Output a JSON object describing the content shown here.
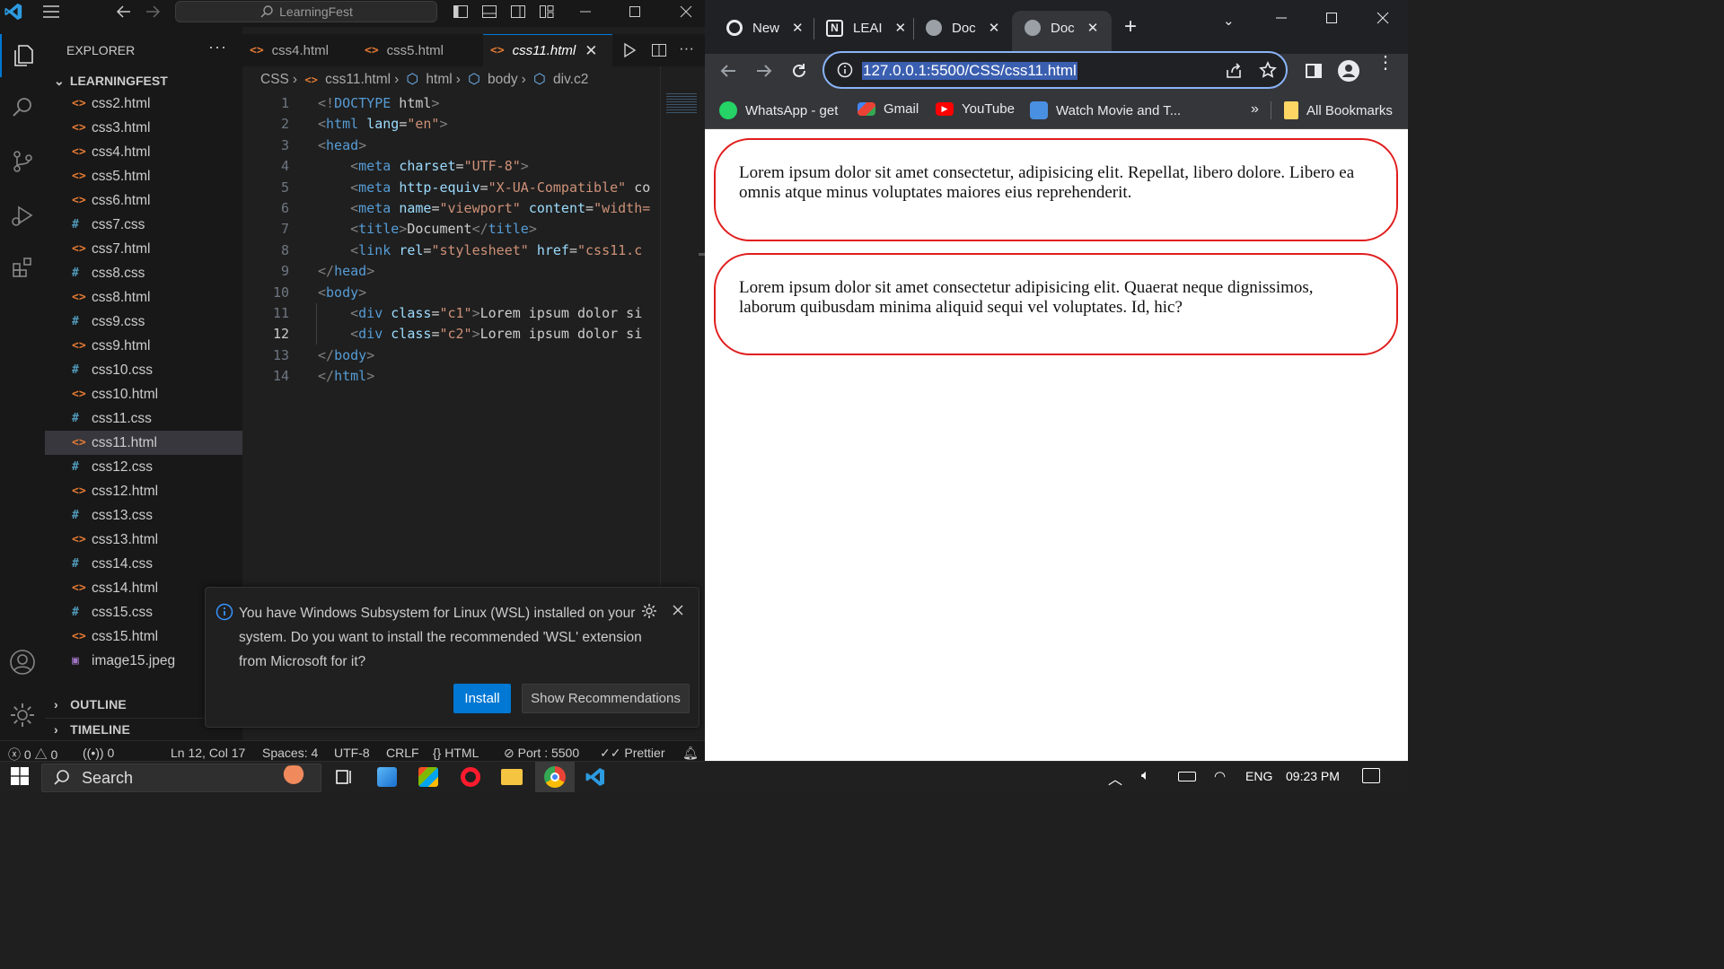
{
  "vscode": {
    "search_text": "LearningFest",
    "explorer_title": "EXPLORER",
    "explorer_more": "···",
    "root_folder": "LEARNINGFEST",
    "files": [
      {
        "name": "css2.html",
        "type": "html"
      },
      {
        "name": "css3.html",
        "type": "html"
      },
      {
        "name": "css4.html",
        "type": "html"
      },
      {
        "name": "css5.html",
        "type": "html"
      },
      {
        "name": "css6.html",
        "type": "html"
      },
      {
        "name": "css7.css",
        "type": "css"
      },
      {
        "name": "css7.html",
        "type": "html"
      },
      {
        "name": "css8.css",
        "type": "css"
      },
      {
        "name": "css8.html",
        "type": "html"
      },
      {
        "name": "css9.css",
        "type": "css"
      },
      {
        "name": "css9.html",
        "type": "html"
      },
      {
        "name": "css10.css",
        "type": "css"
      },
      {
        "name": "css10.html",
        "type": "html"
      },
      {
        "name": "css11.css",
        "type": "css"
      },
      {
        "name": "css11.html",
        "type": "html",
        "selected": true
      },
      {
        "name": "css12.css",
        "type": "css"
      },
      {
        "name": "css12.html",
        "type": "html"
      },
      {
        "name": "css13.css",
        "type": "css"
      },
      {
        "name": "css13.html",
        "type": "html"
      },
      {
        "name": "css14.css",
        "type": "css"
      },
      {
        "name": "css14.html",
        "type": "html"
      },
      {
        "name": "css15.css",
        "type": "css"
      },
      {
        "name": "css15.html",
        "type": "html"
      },
      {
        "name": "image15.jpeg",
        "type": "img"
      }
    ],
    "outline_label": "OUTLINE",
    "timeline_label": "TIMELINE",
    "tabs": [
      {
        "label": "css4.html"
      },
      {
        "label": "css5.html"
      },
      {
        "label": "css11.html",
        "active": true
      }
    ],
    "breadcrumb": [
      "CSS",
      "css11.html",
      "html",
      "body",
      "div.c2"
    ],
    "code_lines": [
      "<!DOCTYPE html>",
      "<html lang=\"en\">",
      "<head>",
      "    <meta charset=\"UTF-8\">",
      "    <meta http-equiv=\"X-UA-Compatible\" co",
      "    <meta name=\"viewport\" content=\"width=",
      "    <title>Document</title>",
      "    <link rel=\"stylesheet\" href=\"css11.c",
      "</head>",
      "<body>",
      "    <div class=\"c1\">Lorem ipsum dolor si",
      "    <div class=\"c2\">Lorem ipsum dolor si",
      "</body>",
      "</html>"
    ],
    "current_line": 12,
    "notification": {
      "message": "You have Windows Subsystem for Linux (WSL) installed on your system. Do you want to install the recommended 'WSL' extension from Microsoft for it?",
      "install_label": "Install",
      "recommend_label": "Show Recommendations"
    },
    "status": {
      "errors": "0",
      "warnings": "0",
      "ports": "0",
      "position": "Ln 12, Col 17",
      "spaces": "Spaces: 4",
      "encoding": "UTF-8",
      "eol": "CRLF",
      "language": "HTML",
      "port": "Port : 5500",
      "formatter": "Prettier"
    }
  },
  "chrome": {
    "tabs": [
      {
        "label": "New"
      },
      {
        "label": "LEAI"
      },
      {
        "label": "Doc"
      },
      {
        "label": "Doc",
        "active": true
      }
    ],
    "url": "127.0.0.1:5500/CSS/css11.html",
    "bookmarks": [
      {
        "label": "WhatsApp - get",
        "color": "#25d366"
      },
      {
        "label": "Gmail",
        "color": "#ea4335"
      },
      {
        "label": "YouTube",
        "color": "#ff0000"
      },
      {
        "label": "Watch Movie and T...",
        "color": "#4a90e2"
      }
    ],
    "bookmarks_more": "»",
    "all_bookmarks": "All Bookmarks",
    "page": {
      "box1": "Lorem ipsum dolor sit amet consectetur, adipisicing elit. Repellat, libero dolore. Libero ea omnis atque minus voluptates maiores eius reprehenderit.",
      "box2": "Lorem ipsum dolor sit amet consectetur adipisicing elit. Quaerat neque dignissimos, laborum quibusdam minima aliquid sequi vel voluptates. Id, hic?"
    },
    "border_color": "#e11d1d"
  },
  "taskbar": {
    "search_label": "Search",
    "language": "ENG",
    "time": "09:23 PM"
  }
}
